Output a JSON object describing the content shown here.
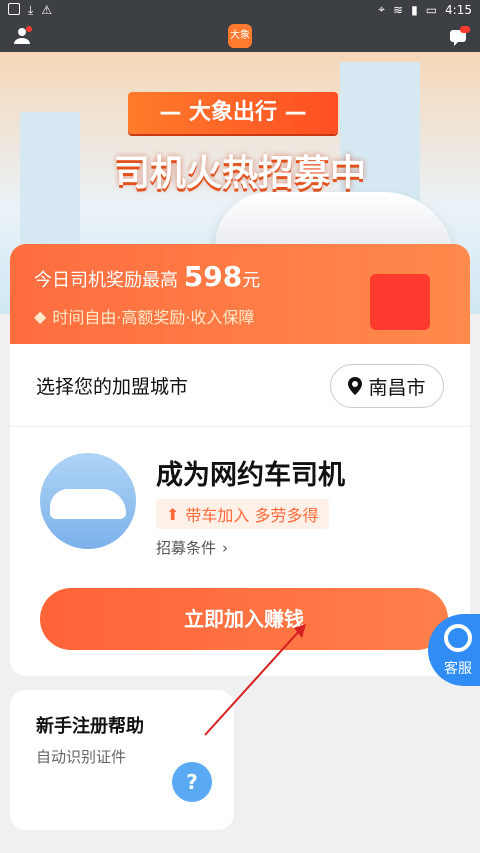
{
  "statusbar": {
    "time": "4:15"
  },
  "appbar": {
    "logo_text": "大象"
  },
  "banner": {
    "brand": "— 大象出行 —",
    "slogan": "司机火热招募中"
  },
  "reward": {
    "prefix": "今日司机奖励最高",
    "amount": "598",
    "unit": "元",
    "sub": "时间自由·高额奖励·收入保障"
  },
  "city": {
    "label": "选择您的加盟城市",
    "selected": "南昌市"
  },
  "driver": {
    "title": "成为网约车司机",
    "tag": "带车加入 多劳多得",
    "recruit_link": "招募条件"
  },
  "join_button": "立即加入赚钱",
  "service_label": "客服",
  "help": {
    "title": "新手注册帮助",
    "sub": "自动识别证件",
    "icon_char": "?"
  },
  "colors": {
    "accent": "#ff6338",
    "service": "#2f8df5"
  }
}
